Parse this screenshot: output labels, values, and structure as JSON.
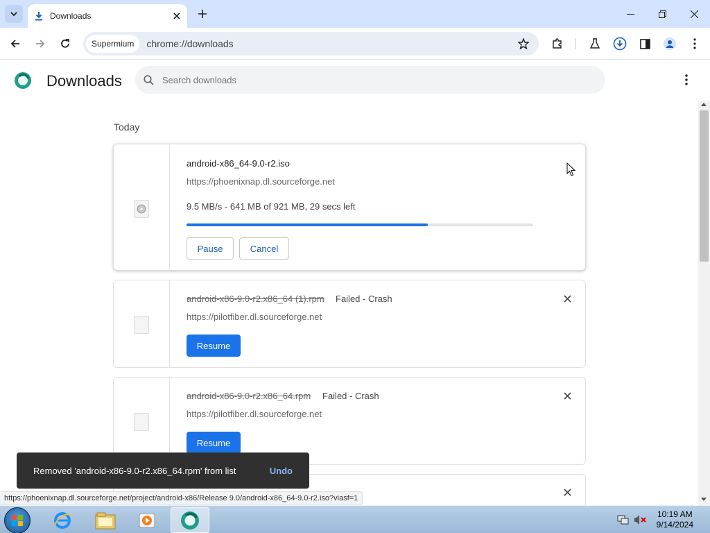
{
  "window": {
    "tab_title": "Downloads",
    "new_tab_label": "+"
  },
  "toolbar": {
    "chip_label": "Supermium",
    "url": "chrome://downloads"
  },
  "page": {
    "title": "Downloads",
    "search_placeholder": "Search downloads"
  },
  "section": {
    "date_label": "Today"
  },
  "downloads": [
    {
      "filename": "android-x86_64-9.0-r2.iso",
      "source": "https://phoenixnap.dl.sourceforge.net",
      "progress_text": "9.5 MB/s - 641 MB of 921 MB, 29 secs left",
      "progress_fraction": 0.696,
      "pause_label": "Pause",
      "cancel_label": "Cancel"
    },
    {
      "filename": "android-x86-9.0-r2.x86_64 (1).rpm",
      "status": "Failed - Crash",
      "source": "https://pilotfiber.dl.sourceforge.net",
      "resume_label": "Resume"
    },
    {
      "filename": "android-x86-9.0-r2.x86_64.rpm",
      "status": "Failed - Crash",
      "source": "https://pilotfiber.dl.sourceforge.net",
      "resume_label": "Resume"
    }
  ],
  "toast": {
    "message": "Removed 'android-x86-9.0-r2.x86_64.rpm' from list",
    "undo_label": "Undo"
  },
  "status_bar": {
    "url": "https://phoenixnap.dl.sourceforge.net/project/android-x86/Release 9.0/android-x86_64-9.0-r2.iso?viasf=1"
  },
  "taskbar": {
    "time": "10:19 AM",
    "date": "9/14/2024"
  },
  "colors": {
    "accent": "#1a73e8",
    "titlebar": "#d3e3fd",
    "toast_bg": "#303030"
  }
}
